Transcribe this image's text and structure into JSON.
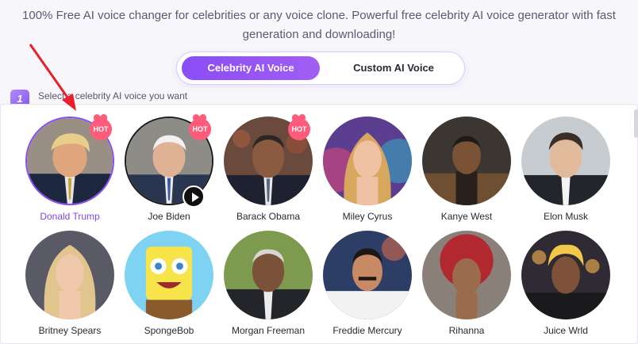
{
  "intro": {
    "line1": "100% Free AI voice changer for celebrities or any voice clone. Powerful free celebrity AI voice generator with fast",
    "line2": "generation and downloading!"
  },
  "tabs": [
    {
      "label": "Celebrity AI Voice",
      "active": true
    },
    {
      "label": "Custom AI Voice",
      "active": false
    }
  ],
  "step": {
    "number": "1",
    "label": "Select a celebrity AI voice you want"
  },
  "badge_hot": "HOT",
  "colors": {
    "accent": "#8a4df5",
    "hot": "#ff5b7a",
    "selected_text": "#7d45ee"
  },
  "voices": [
    {
      "name": "Donald Trump",
      "hot": true,
      "selected": true
    },
    {
      "name": "Joe Biden",
      "hot": true,
      "selected": false,
      "playing": true
    },
    {
      "name": "Barack Obama",
      "hot": true,
      "selected": false
    },
    {
      "name": "Miley Cyrus",
      "hot": false,
      "selected": false
    },
    {
      "name": "Kanye West",
      "hot": false,
      "selected": false
    },
    {
      "name": "Elon Musk",
      "hot": false,
      "selected": false
    },
    {
      "name": "Britney Spears",
      "hot": false,
      "selected": false
    },
    {
      "name": "SpongeBob",
      "hot": false,
      "selected": false
    },
    {
      "name": "Morgan Freeman",
      "hot": false,
      "selected": false
    },
    {
      "name": "Freddie Mercury",
      "hot": false,
      "selected": false
    },
    {
      "name": "Rihanna",
      "hot": false,
      "selected": false
    },
    {
      "name": "Juice Wrld",
      "hot": false,
      "selected": false
    }
  ]
}
